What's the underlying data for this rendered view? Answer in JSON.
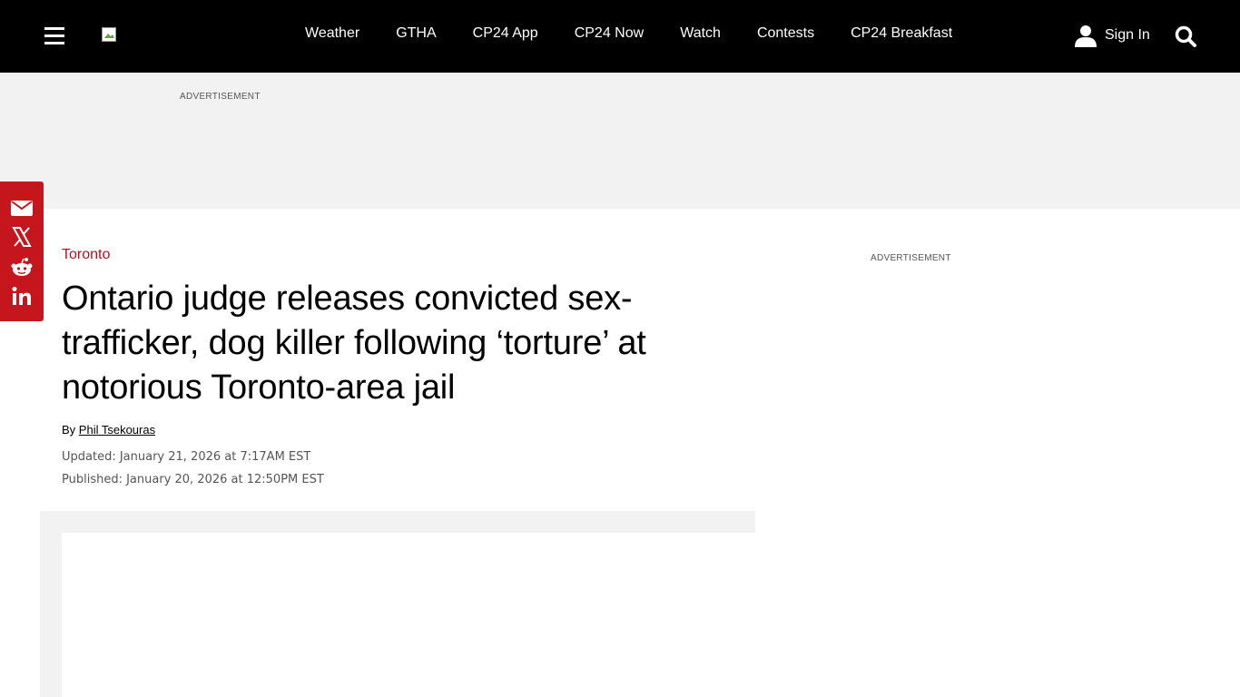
{
  "header": {
    "nav": [
      "Weather",
      "GTHA",
      "CP24 App",
      "CP24 Now",
      "Watch",
      "Contests",
      "CP24 Breakfast"
    ],
    "sign_in": "Sign In"
  },
  "ads": {
    "top_label": "ADVERTISEMENT",
    "side_label": "ADVERTISEMENT"
  },
  "share": [
    "email-icon",
    "x-icon",
    "reddit-icon",
    "linkedin-icon"
  ],
  "article": {
    "kicker": "Toronto",
    "headline": "Ontario judge releases convicted sex-trafficker, dog killer following ‘torture’ at notorious Toronto-area jail",
    "by_prefix": "By",
    "author": "Phil Tsekouras",
    "updated": "Updated: January 21, 2026 at 7:17AM EST",
    "published": "Published: January 20, 2026 at 12:50PM EST"
  },
  "colors": {
    "header_bg": "#000000",
    "accent": "#c4161c",
    "kicker": "#b5121b",
    "ad_bg": "#f2f2f2"
  }
}
